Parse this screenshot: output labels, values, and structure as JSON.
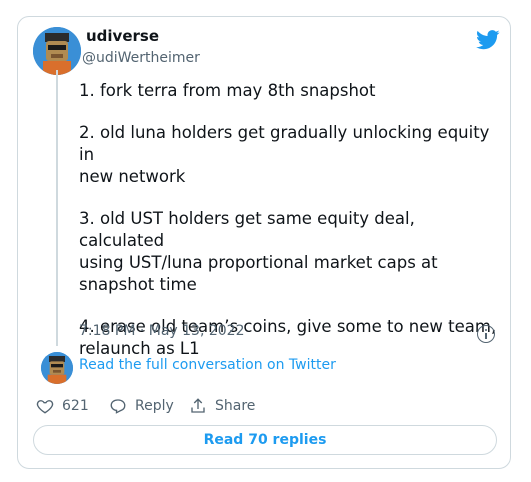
{
  "tweet": {
    "author_name": "udiverse",
    "author_handle": "@udiWertheimer",
    "paragraphs": [
      "1. fork terra from may 8th snapshot",
      "2. old luna holders get gradually unlocking equity in\nnew network",
      "3. old UST holders get same equity deal, calculated\nusing UST/luna proportional market caps at\nsnapshot time",
      "4. erase old team’s coins, give some to new team,\nrelaunch as L1"
    ],
    "timestamp": "7:18 PM · May 13, 2022"
  },
  "conversation_link": "Read the full conversation on Twitter",
  "actions": {
    "like_count": "621",
    "reply_label": "Reply",
    "share_label": "Share"
  },
  "replies_button": "Read 70 replies",
  "colors": {
    "accent": "#1d9bf0",
    "secondary_text": "#536471",
    "border": "#cfd9de"
  },
  "icons": [
    "twitter-bird-icon",
    "info-icon",
    "heart-icon",
    "reply-icon",
    "share-icon"
  ]
}
